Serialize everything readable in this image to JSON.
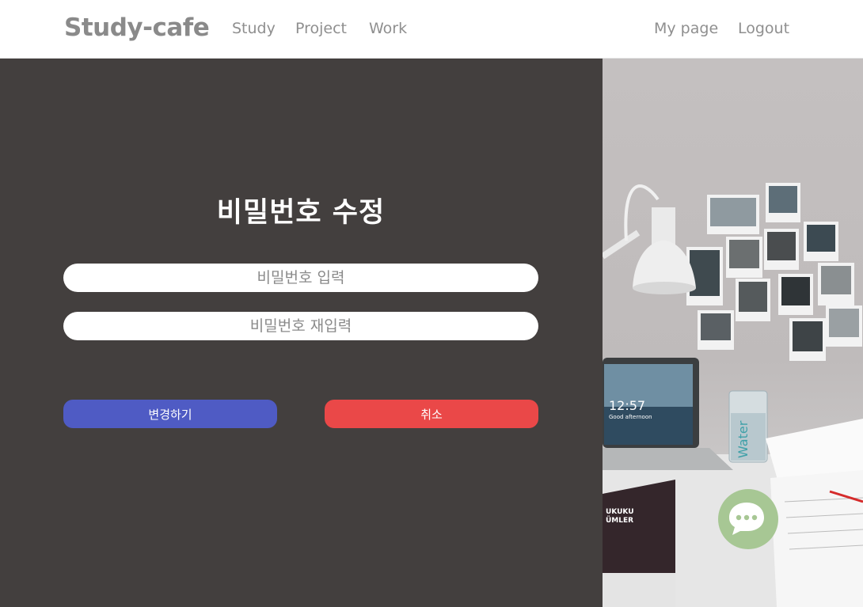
{
  "nav": {
    "brand": "Study-cafe",
    "links": [
      "Study",
      "Project",
      "Work"
    ],
    "right_links": [
      "My page",
      "Logout"
    ]
  },
  "form": {
    "title": "비밀번호 수정",
    "password_placeholder": "비밀번호 입력",
    "password_confirm_placeholder": "비밀번호 재입력",
    "submit_label": "변경하기",
    "cancel_label": "취소"
  },
  "photo": {
    "laptop_clock": "12:57",
    "laptop_subtitle": "Good afternoon",
    "glass_text": "Water",
    "book_title": [
      "UKUKU",
      "ÜMLER"
    ]
  },
  "colors": {
    "nav_text": "#8f8f8f",
    "panel_bg": "#433f3e",
    "submit_button": "#4f5bc4",
    "cancel_button": "#ea4848",
    "chat_button": "#a7c794"
  },
  "icons": {
    "chat": "chat-bubble-icon"
  }
}
